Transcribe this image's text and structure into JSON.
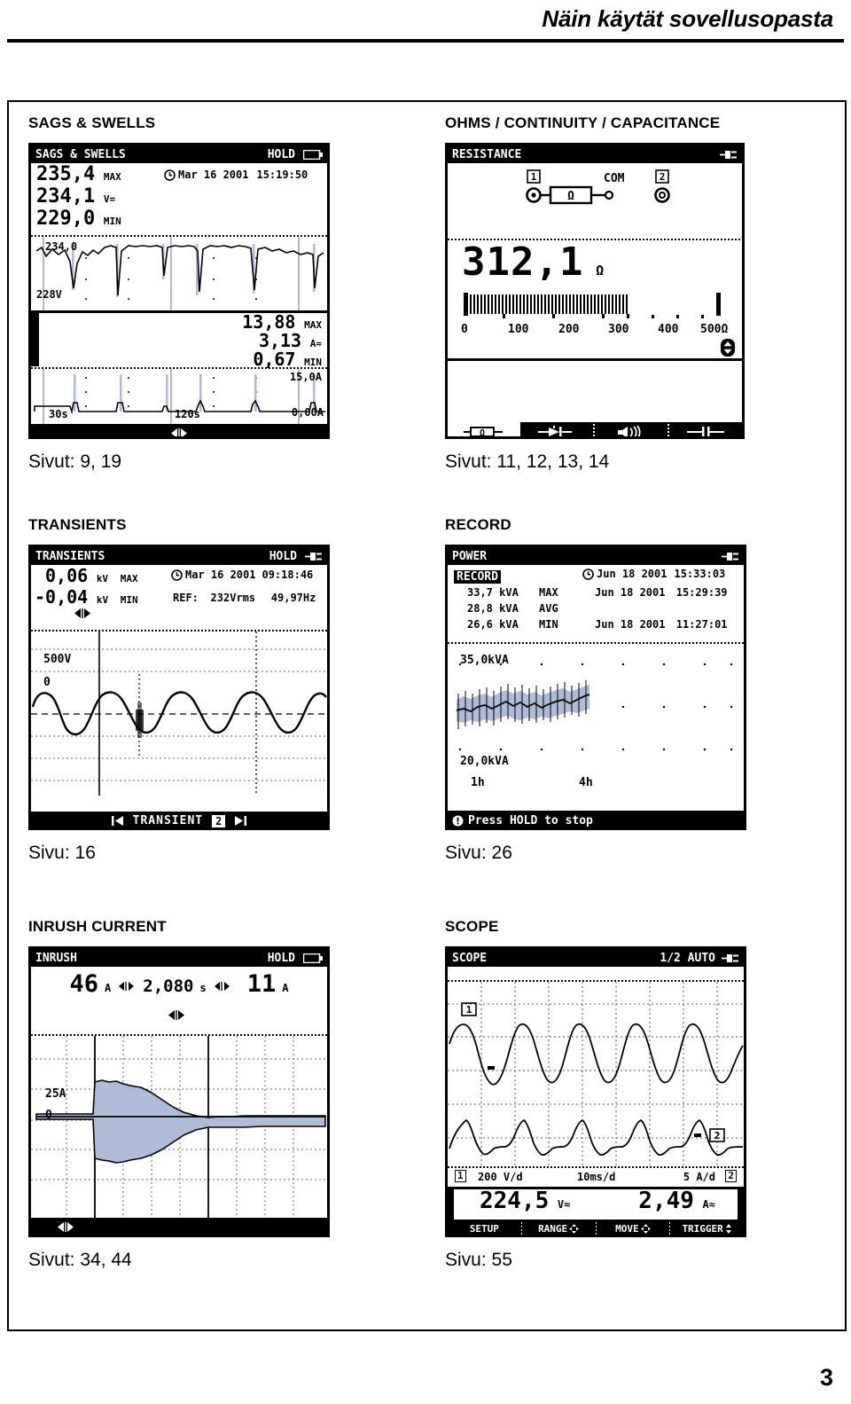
{
  "header": {
    "title": "Näin käytät sovellusopasta"
  },
  "page_number": "3",
  "cells": [
    {
      "title": "SAGS & SWELLS",
      "caption": "Sivut: 9, 19",
      "screen": {
        "titlebar_left": "SAGS  & SWELLS",
        "titlebar_right": "HOLD",
        "battery_icon": "battery-icon",
        "clock_icon": "clock-icon",
        "v_max": "235,4",
        "v_max_unit": "MAX",
        "v_now": "234,1",
        "v_now_unit": "V=",
        "v_min": "229,0",
        "v_min_unit": "MIN",
        "date": "Mar 16 2001",
        "time": "15:19:50",
        "v_top_scale": "234,0",
        "v_bottom_scale": "228V",
        "a_max": "13,88",
        "a_max_unit": "MAX",
        "a_now": "3,13",
        "a_now_unit": "A≈",
        "a_min": "0,67",
        "a_min_unit": "MIN",
        "a_top_scale": "15,0A",
        "a_bottom_scale": "0,00A",
        "t_left": "30s",
        "t_mid": "120s",
        "softkey_icon": "left-right-arrows-icon"
      }
    },
    {
      "title": "OHMS / CONTINUITY / CAPACITANCE",
      "caption": "Sivut: 11, 12, 13, 14",
      "screen": {
        "titlebar_left": "RESISTANCE",
        "plug_icon": "mains-plug-icon",
        "input1_label": "1",
        "input2_label": "2",
        "com_label": "COM",
        "resistor_symbol": "Ω",
        "value": "312,1",
        "value_unit": "Ω",
        "bar_ticks": [
          "0",
          "100",
          "200",
          "300",
          "400",
          "500Ω"
        ],
        "bar_fill_percent": 62,
        "updown_icon": "up-down-arrows-icon",
        "softkeys": [
          "resistance-icon",
          "diode-icon",
          "continuity-beeper-icon",
          "capacitance-icon"
        ]
      }
    },
    {
      "title": "TRANSIENTS",
      "caption": "Sivu: 16",
      "screen": {
        "titlebar_left": "TRANSIENTS",
        "titlebar_right": "HOLD",
        "plug_icon": "mains-plug-icon",
        "clock_icon": "clock-icon",
        "max_value": "0,06",
        "max_unit": "kV",
        "max_label": "MAX",
        "min_value": "-0,04",
        "min_unit": "kV",
        "min_label": "MIN",
        "date": "Mar 16 2001",
        "time": "09:18:46",
        "ref_label": "REF:",
        "ref_voltage": "232Vrms",
        "ref_frequency": "49,97Hz",
        "cursor_icon": "left-right-arrows-icon",
        "y_scale": "500V",
        "y_zero": "0",
        "softkey_label": "TRANSIENT",
        "softkey_number": "2",
        "prev_icon": "skip-previous-icon",
        "next_icon": "skip-next-icon"
      }
    },
    {
      "title": "RECORD",
      "caption": "Sivu: 26",
      "screen": {
        "titlebar_left": "POWER",
        "plug_icon": "mains-plug-icon",
        "mode_badge": "RECORD",
        "clock_icon": "clock-icon",
        "header_date": "Jun 18 2001",
        "header_time": "15:33:03",
        "rows": [
          {
            "value": "33,7 kVA",
            "label": "MAX",
            "date": "Jun 18 2001",
            "time": "15:29:39"
          },
          {
            "value": "28,8 kVA",
            "label": "AVG",
            "date": "",
            "time": ""
          },
          {
            "value": "26,6 kVA",
            "label": "MIN",
            "date": "Jun 18 2001",
            "time": "11:27:01"
          }
        ],
        "y_top": "35,0kVA",
        "y_bottom": "20,0kVA",
        "x_left": "1h",
        "x_mid": "4h",
        "status_icon": "info-icon",
        "status_text": "Press HOLD to stop"
      }
    },
    {
      "title": "INRUSH CURRENT",
      "caption": "Sivut: 34, 44",
      "screen": {
        "titlebar_left": "INRUSH",
        "titlebar_right": "HOLD",
        "battery_icon": "battery-icon",
        "value_left": "46",
        "value_left_unit": "A",
        "duration": "2,080",
        "duration_unit": "s",
        "value_right": "11",
        "value_right_unit": "A",
        "arrows_left_icon": "left-right-arrows-icon",
        "arrows_right_icon": "left-right-arrows-icon",
        "cursor_icon": "left-right-arrows-icon",
        "y_scale": "25A",
        "y_zero": "0",
        "softkey_icon": "left-right-arrows-icon"
      }
    },
    {
      "title": "SCOPE",
      "caption": "Sivu: 55",
      "screen": {
        "titlebar_left": "SCOPE",
        "titlebar_right": "1/2 AUTO",
        "plug_icon": "mains-plug-icon",
        "trace1_marker": "1",
        "trace2_marker": "2",
        "ch1_badge": "1",
        "ch1_scale": "200 V/d",
        "time_scale": "10ms/d",
        "ch2_scale": "5 A/d",
        "ch2_badge": "2",
        "reading1": "224,5",
        "reading1_unit": "V≈",
        "reading2": "2,49",
        "reading2_unit": "A≈",
        "softkeys": [
          "SETUP",
          "RANGE",
          "MOVE",
          "TRIGGER"
        ]
      }
    }
  ],
  "colors": {
    "ink": "#000000",
    "trace_fill": "#aebcd8",
    "paper": "#ffffff"
  }
}
